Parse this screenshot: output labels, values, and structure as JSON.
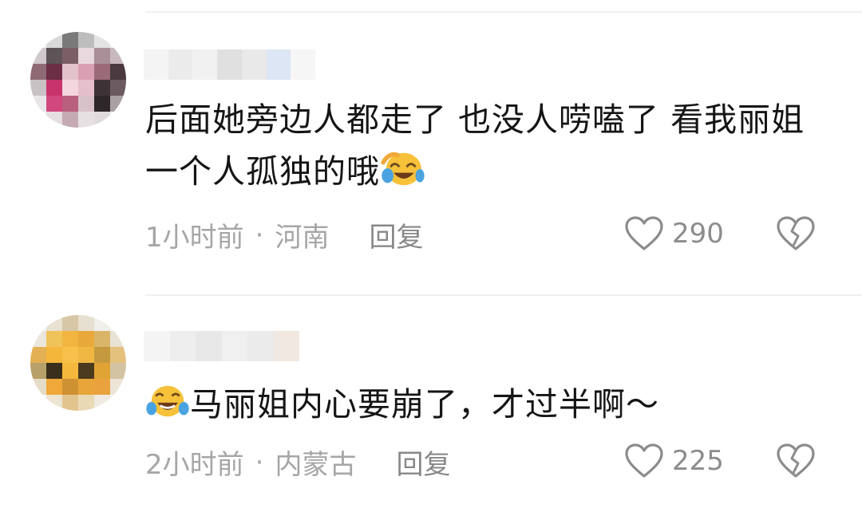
{
  "comments": [
    {
      "text": "后面她旁边人都走了 也没人唠嗑了 看我丽姐一个人孤独的哦",
      "emoji": "grinning-squinting-tears-emoji",
      "time": "1小时前",
      "location": "河南",
      "separator": "·",
      "reply_label": "回复",
      "likes": "290"
    },
    {
      "text": "马丽姐内心要崩了，才过半啊～",
      "emoji": "laughing-tears-emoji",
      "time": "2小时前",
      "location": "内蒙古",
      "separator": "·",
      "reply_label": "回复",
      "likes": "225"
    }
  ],
  "icons": {
    "like": "heart-outline-icon",
    "dislike": "broken-heart-icon"
  },
  "colors": {
    "meta_text": "#a6a6a6",
    "icon_gray": "#8c8c8c",
    "emoji_yellow": "#f7c23a",
    "emoji_tear": "#4aa3e0"
  }
}
